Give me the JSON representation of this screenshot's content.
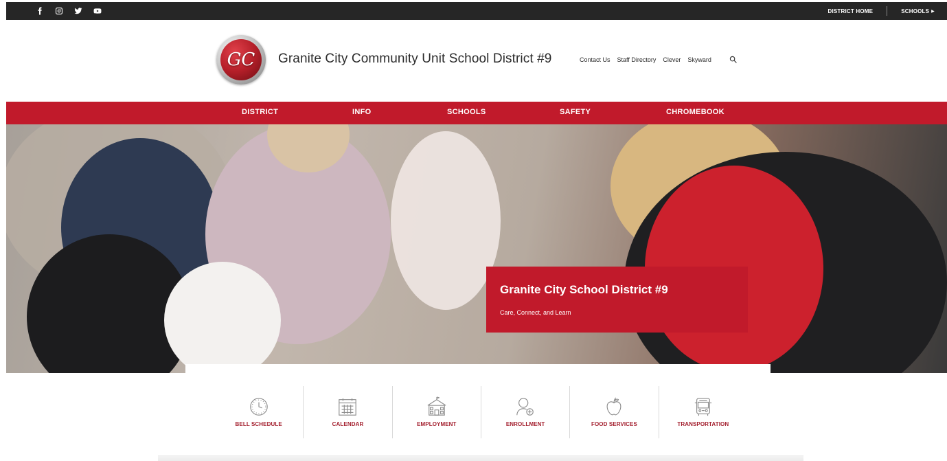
{
  "topbar": {
    "social": [
      {
        "name": "facebook-icon"
      },
      {
        "name": "instagram-icon"
      },
      {
        "name": "twitter-icon"
      },
      {
        "name": "youtube-icon"
      }
    ],
    "district_home": "DISTRICT HOME",
    "schools": "SCHOOLS"
  },
  "header": {
    "logo_text": "GC",
    "title": "Granite City Community Unit School District #9",
    "links": [
      "Contact Us",
      "Staff Directory",
      "Clever",
      "Skyward"
    ]
  },
  "nav": [
    "DISTRICT",
    "INFO",
    "SCHOOLS",
    "SAFETY",
    "CHROMEBOOK"
  ],
  "hero": {
    "title": "Granite City School District #9",
    "subtitle": "Care, Connect, and Learn"
  },
  "quicklinks": [
    {
      "label": "BELL SCHEDULE",
      "icon": "clock-icon"
    },
    {
      "label": "CALENDAR",
      "icon": "calendar-icon"
    },
    {
      "label": "EMPLOYMENT",
      "icon": "school-building-icon"
    },
    {
      "label": "ENROLLMENT",
      "icon": "add-user-icon"
    },
    {
      "label": "FOOD SERVICES",
      "icon": "apple-icon"
    },
    {
      "label": "TRANSPORTATION",
      "icon": "bus-icon"
    }
  ],
  "colors": {
    "brand_red": "#c11a2b",
    "topbar_bg": "#262626",
    "quicklink_text": "#a31e2d"
  }
}
